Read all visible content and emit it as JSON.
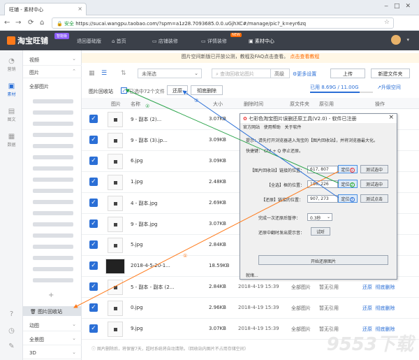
{
  "browser": {
    "tab_title": "旺铺 - 素材中心",
    "secure_label": "安全",
    "url": "https://sucai.wangpu.taobao.com/?spm=a1z28.7093685.0.0.uGjhXC#/manage/pic?_k=eyr6zq"
  },
  "header": {
    "logo": "淘宝旺铺",
    "badge": "智能版",
    "back": "退回基础版",
    "nav": [
      "首页",
      "店铺装修",
      "详情装修",
      "素材中心"
    ],
    "nav_new": "NEW"
  },
  "sidebar": {
    "items": [
      "营销",
      "素材",
      "图文",
      "数据"
    ]
  },
  "folder": {
    "video": "视频",
    "images": "图片",
    "all_images": "全部图片",
    "add": "+",
    "recycle": "图片回收站",
    "animated": "动图",
    "panorama": "全景图",
    "three_d": "3D"
  },
  "notice": {
    "text": "图片空间新版已开放公测，教程及FAQ点击查看。",
    "link": "点击查看教程"
  },
  "toolbar": {
    "filter": "未筛选",
    "search_placeholder": "查询回收站图片",
    "advanced": "高级",
    "more": "更多设置",
    "upload": "上传",
    "new_folder": "新建文件夹"
  },
  "subbar": {
    "title": "图片回收站",
    "selected": "已选中72个文件",
    "restore": "还原",
    "delete": "彻底删除",
    "usage": "已用 8.69G / 11.00G",
    "upgrade": "升级空间",
    "usage_fraction": 0.79
  },
  "table": {
    "headers": [
      "图片",
      "名称",
      "大小",
      "删除时间",
      "原文件夹",
      "原引用",
      "操作"
    ],
    "rows": [
      {
        "name": "9 - 副本 (2)...",
        "size": "3.07KB",
        "time": "",
        "folder": "",
        "ref": "",
        "restore": "",
        "delete": ""
      },
      {
        "name": "9 - 副本 (3).jp...",
        "size": "3.09KB",
        "time": "",
        "folder": "",
        "ref": "",
        "restore": "",
        "delete": ""
      },
      {
        "name": "6.jpg",
        "size": "3.09KB",
        "time": "",
        "folder": "",
        "ref": "",
        "restore": "",
        "delete": ""
      },
      {
        "name": "1.jpg",
        "size": "2.48KB",
        "time": "",
        "folder": "",
        "ref": "",
        "restore": "",
        "delete": ""
      },
      {
        "name": "4 - 副本.jpg",
        "size": "2.69KB",
        "time": "",
        "folder": "",
        "ref": "",
        "restore": "",
        "delete": ""
      },
      {
        "name": "9 - 副本.jpg",
        "size": "3.07KB",
        "time": "",
        "folder": "",
        "ref": "",
        "restore": "",
        "delete": ""
      },
      {
        "name": "5.jpg",
        "size": "2.84KB",
        "time": "",
        "folder": "",
        "ref": "",
        "restore": "",
        "delete": ""
      },
      {
        "name": "2018-4-5-20-1...",
        "size": "18.59KB",
        "time": "",
        "folder": "",
        "ref": "",
        "restore": "",
        "delete": ""
      },
      {
        "name": "5 - 副本 - 副本 (2...",
        "size": "2.84KB",
        "time": "2018-4-19 15:39",
        "folder": "全部图片",
        "ref": "暂无引用",
        "restore": "还原",
        "delete": "彻底删除"
      },
      {
        "name": "0.jpg",
        "size": "2.96KB",
        "time": "2018-4-19 15:39",
        "folder": "全部图片",
        "ref": "暂无引用",
        "restore": "还原",
        "delete": "彻底删除"
      },
      {
        "name": "9.jpg",
        "size": "3.07KB",
        "time": "2018-4-19 15:39",
        "folder": "全部图片",
        "ref": "暂无引用",
        "restore": "还原",
        "delete": "彻底删除"
      }
    ]
  },
  "dialog": {
    "title": "七彩色淘宝图片误删还原工具(V2.0) - 软件已注册",
    "menu": [
      "官方网站",
      "使用帮助",
      "关于软件"
    ],
    "tip1": "提示：请先打开浏览器进入淘宝的【图片回收站】，并将浏览器最大化。",
    "tip2": "快捷键：  Ctrl + Q 停止还原。",
    "rows": [
      {
        "label": "【图片回收站】链接的位置：",
        "value": "617, 807",
        "locate": "定位",
        "badge": "1",
        "test": "测试选中"
      },
      {
        "label": "【全选】框的位置：",
        "value": "186, 226",
        "locate": "定位",
        "badge": "2",
        "test": "测试选中"
      },
      {
        "label": "【还原】链接的位置：",
        "value": "907, 273",
        "locate": "定位",
        "badge": "3",
        "test": "测试点击"
      }
    ],
    "delay_label": "完成一次还原后暂停：",
    "delay_value": "0.3秒",
    "prompt_label": "还原中翻时发出提示音：",
    "test": "试听",
    "start": "开始还原图片",
    "status": "就绪..."
  },
  "annotations": [
    "①",
    "②",
    "③"
  ],
  "footer": {
    "text": "图片删除后，将保留7天，超时系统将自动清除。（回收站内图片不占用存储空间）"
  },
  "watermark": "9553下载"
}
